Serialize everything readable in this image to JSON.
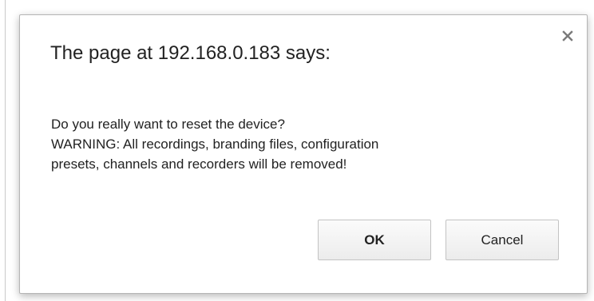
{
  "dialog": {
    "title": "The page at 192.168.0.183 says:",
    "message_lines": [
      "Do you really want to reset the device?",
      "WARNING: All recordings, branding files, configuration",
      "presets, channels and recorders will be removed!"
    ],
    "ok_label": "OK",
    "cancel_label": "Cancel",
    "close_icon": "close-icon"
  }
}
